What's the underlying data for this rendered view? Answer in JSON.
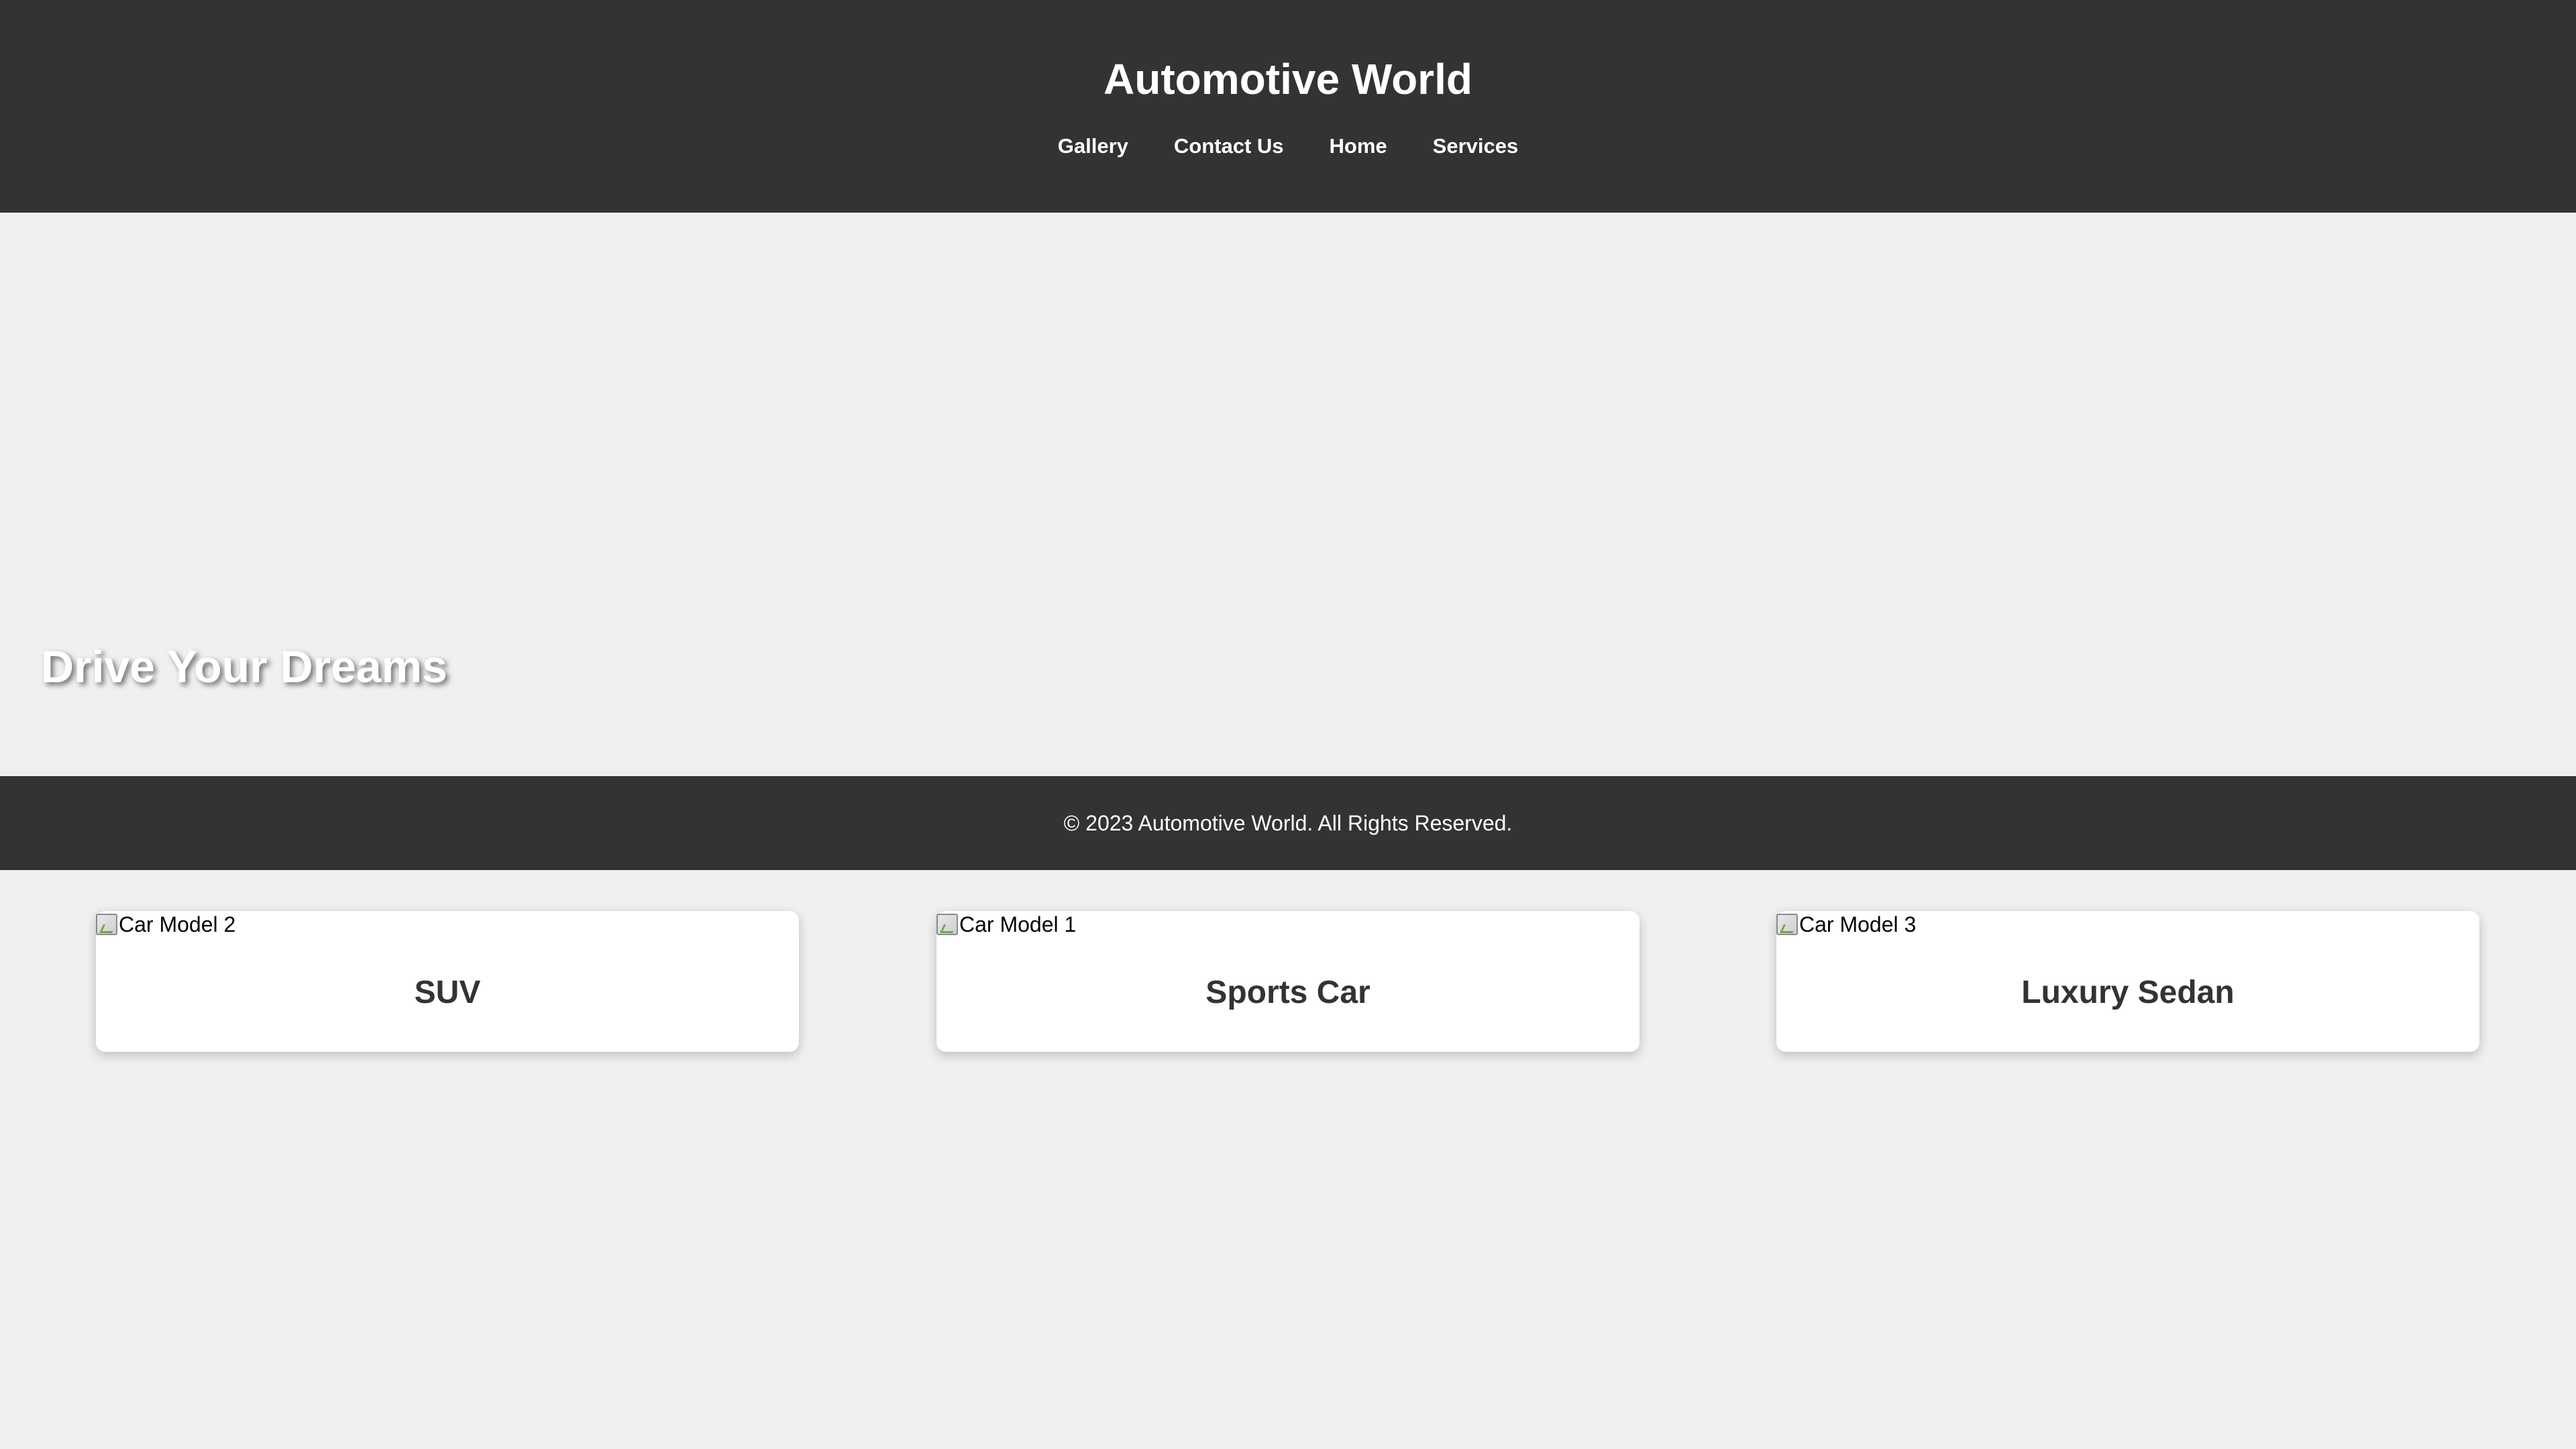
{
  "header": {
    "title": "Automotive World",
    "nav": [
      "Gallery",
      "Contact Us",
      "Home",
      "Services"
    ]
  },
  "hero": {
    "heading": "Drive Your Dreams"
  },
  "footer": {
    "copyright": "© 2023 Automotive World. All Rights Reserved."
  },
  "cards": [
    {
      "img_alt": "Car Model 2",
      "title": "SUV"
    },
    {
      "img_alt": "Car Model 1",
      "title": "Sports Car"
    },
    {
      "img_alt": "Car Model 3",
      "title": "Luxury Sedan"
    }
  ],
  "colors": {
    "header_bg": "#333333",
    "page_bg": "#f0f0f0",
    "card_bg": "#ffffff",
    "header_text": "#ffffff",
    "card_title": "#333333"
  }
}
